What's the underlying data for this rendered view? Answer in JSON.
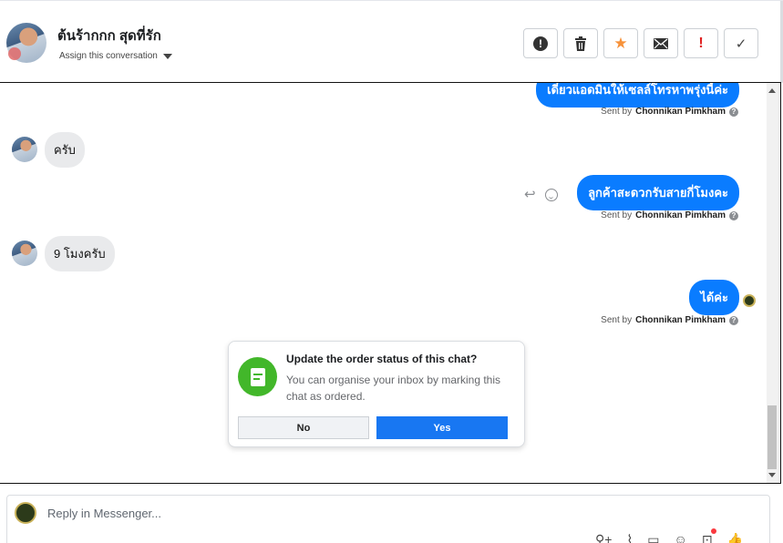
{
  "header": {
    "contact_name": "ต้นร้ากกก สุดที่รัก",
    "assign_label": "Assign this conversation",
    "toolbar": [
      {
        "name": "mark-spam-button",
        "icon": "alert-circle-icon"
      },
      {
        "name": "delete-button",
        "icon": "trash-icon"
      },
      {
        "name": "star-button",
        "icon": "star-icon"
      },
      {
        "name": "mark-unread-button",
        "icon": "envelope-icon"
      },
      {
        "name": "follow-up-button",
        "icon": "exclamation-icon"
      },
      {
        "name": "mark-done-button",
        "icon": "checkmark-icon"
      }
    ]
  },
  "messages": [
    {
      "dir": "out",
      "text": "เดี๋ยวแอดมินให้เซลล์โทรหาพรุ่งนี้ค่ะ",
      "sent_label": "Sent by",
      "sender": "Chonnikan Pimkham"
    },
    {
      "dir": "in",
      "text": "ครับ"
    },
    {
      "dir": "out",
      "text": "ลูกค้าสะดวกรับสายกี่โมงคะ",
      "sent_label": "Sent by",
      "sender": "Chonnikan Pimkham"
    },
    {
      "dir": "in",
      "text": "9 โมงครับ"
    },
    {
      "dir": "out",
      "text": "ได้ค่ะ",
      "sent_label": "Sent by",
      "sender": "Chonnikan Pimkham"
    }
  ],
  "popup": {
    "title": "Update the order status of this chat?",
    "body": "You can organise your inbox by marking this chat as ordered.",
    "no_label": "No",
    "yes_label": "Yes"
  },
  "composer": {
    "placeholder": "Reply in Messenger..."
  },
  "colors": {
    "accent": "#0a7cff",
    "yes_button": "#1877f2",
    "popup_icon": "#42b72a",
    "star": "#f7923a",
    "flag": "#e02020"
  }
}
